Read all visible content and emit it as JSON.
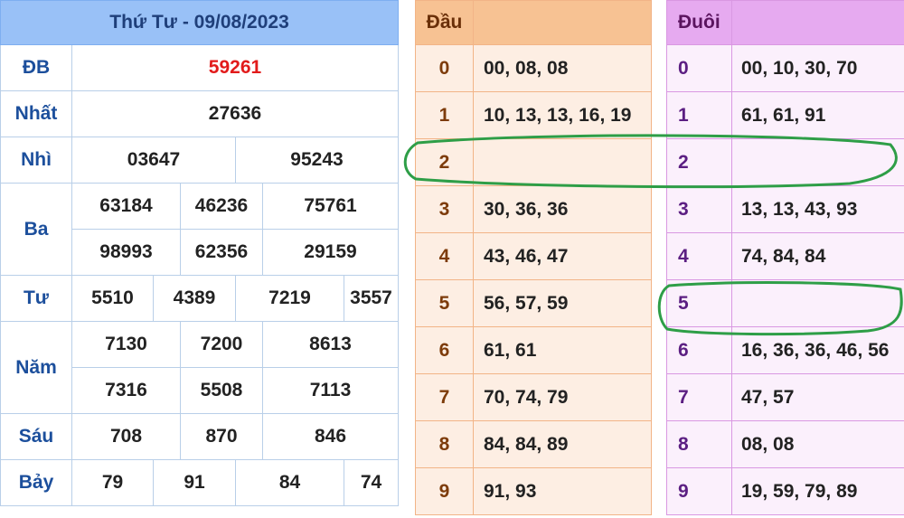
{
  "results": {
    "title": "Thứ Tư - 09/08/2023",
    "rows": {
      "db": {
        "label": "ĐB",
        "values": [
          "59261"
        ]
      },
      "nhat": {
        "label": "Nhất",
        "values": [
          "27636"
        ]
      },
      "nhi": {
        "label": "Nhì",
        "values": [
          "03647",
          "95243"
        ]
      },
      "ba": {
        "label": "Ba",
        "values": [
          "63184",
          "46236",
          "75761",
          "98993",
          "62356",
          "29159"
        ]
      },
      "tu": {
        "label": "Tư",
        "values": [
          "5510",
          "4389",
          "7219",
          "3557"
        ]
      },
      "nam": {
        "label": "Năm",
        "values": [
          "7130",
          "7200",
          "8613",
          "7316",
          "5508",
          "7113"
        ]
      },
      "sau": {
        "label": "Sáu",
        "values": [
          "708",
          "870",
          "846"
        ]
      },
      "bay": {
        "label": "Bảy",
        "values": [
          "79",
          "91",
          "84",
          "74"
        ]
      }
    }
  },
  "dau": {
    "header": "Đầu",
    "rows": [
      {
        "k": "0",
        "v": "00, 08, 08"
      },
      {
        "k": "1",
        "v": "10, 13, 13, 16, 19"
      },
      {
        "k": "2",
        "v": ""
      },
      {
        "k": "3",
        "v": "30, 36, 36"
      },
      {
        "k": "4",
        "v": "43, 46, 47"
      },
      {
        "k": "5",
        "v": "56, 57, 59"
      },
      {
        "k": "6",
        "v": "61, 61"
      },
      {
        "k": "7",
        "v": "70, 74, 79"
      },
      {
        "k": "8",
        "v": "84, 84, 89"
      },
      {
        "k": "9",
        "v": "91, 93"
      }
    ]
  },
  "duoi": {
    "header": "Đuôi",
    "rows": [
      {
        "k": "0",
        "v": "00, 10, 30, 70"
      },
      {
        "k": "1",
        "v": "61, 61, 91"
      },
      {
        "k": "2",
        "v": ""
      },
      {
        "k": "3",
        "v": "13, 13, 43, 93"
      },
      {
        "k": "4",
        "v": "74, 84, 84"
      },
      {
        "k": "5",
        "v": ""
      },
      {
        "k": "6",
        "v": "16, 36, 36, 46, 56"
      },
      {
        "k": "7",
        "v": "47, 57"
      },
      {
        "k": "8",
        "v": "08, 08"
      },
      {
        "k": "9",
        "v": "19, 59, 79, 89"
      }
    ]
  },
  "colors": {
    "results_header": "#99c1f7",
    "dau_header": "#f7c293",
    "duoi_header": "#e6aaf0",
    "highlight": "#2e9e47",
    "special_prize": "#e21b1b"
  }
}
